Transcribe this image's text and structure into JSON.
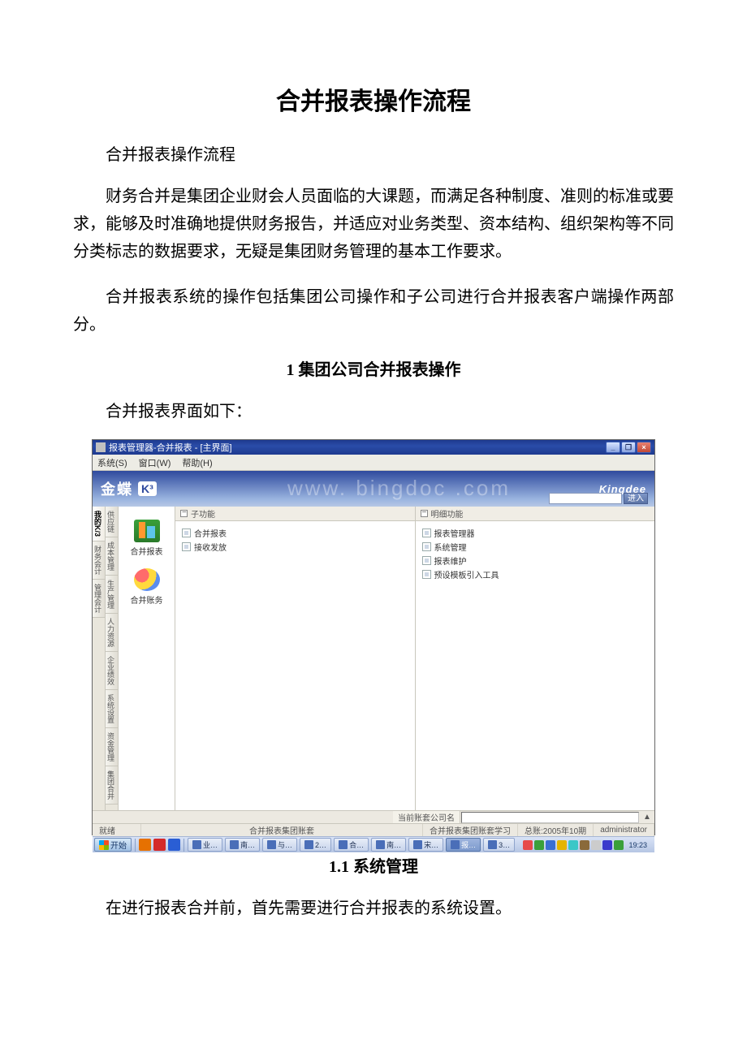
{
  "doc": {
    "title": "合并报表操作流程",
    "subtitle": "合并报表操作流程",
    "para1": "财务合并是集团企业财会人员面临的大课题，而满足各种制度、准则的标准或要求，能够及时准确地提供财务报告，并适应对业务类型、资本结构、组织架构等不同分类标志的数据要求，无疑是集团财务管理的基本工作要求。",
    "para2": "合并报表系统的操作包括集团公司操作和子公司进行合并报表客户端操作两部分。",
    "section1_title": "1 集团公司合并报表操作",
    "section1_intro": "合并报表界面如下：",
    "section1_1_title": "1.1 系统管理",
    "section1_1_body": "在进行报表合并前，首先需要进行合并报表的系统设置。"
  },
  "screenshot": {
    "title_bar": "报表管理器-合并报表 - [主界面]",
    "menus": [
      "系统(S)",
      "窗口(W)",
      "帮助(H)"
    ],
    "logo_main": "金蝶",
    "logo_k3": "K³",
    "brand_right": "Kingdee",
    "watermark": "www. bingdoc .com",
    "enter_btn": "进入",
    "sidebar_tabs_left": [
      "我的K/3",
      "财务会计",
      "管理会计"
    ],
    "sidebar_tabs_right": [
      "供应链",
      "成本管理",
      "生产管理",
      "人力资源",
      "企业绩效",
      "系统设置",
      "资金管理",
      "集团合并"
    ],
    "sidebar_items": [
      {
        "label": "合并报表"
      },
      {
        "label": "合并账务"
      }
    ],
    "panel_sub_title": "子功能",
    "panel_sub_items": [
      "合并报表",
      "接收发放"
    ],
    "panel_detail_title": "明细功能",
    "panel_detail_items": [
      "报表管理器",
      "系统管理",
      "报表维护",
      "预设模板引入工具"
    ],
    "status_label_company": "当前账套公司名",
    "status_ready": "就绪",
    "status_center": "合并报表集团账套",
    "status_right1": "合并报表集团账套学习",
    "status_right2": "总账:2005年10期",
    "status_right3": "administrator",
    "taskbar": {
      "start": "开始",
      "tasks": [
        "业…",
        "南…",
        "与…",
        "2…",
        "合…",
        "南…",
        "宋…",
        "报…",
        "3…"
      ],
      "active_index": 7,
      "time": "19:23"
    }
  }
}
